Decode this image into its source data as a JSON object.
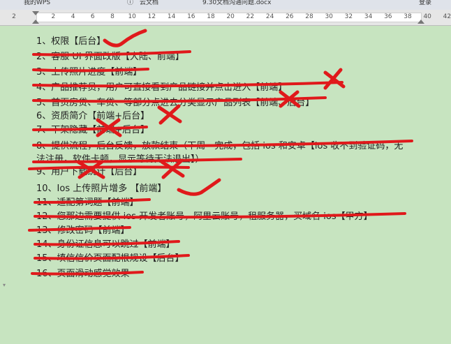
{
  "tabs": [
    {
      "label": "我的WPS"
    },
    {
      "label": "云文档"
    },
    {
      "label": "9.30文档沟通问题.docx"
    },
    {
      "label": "登录"
    }
  ],
  "ruler": {
    "ticks": [
      "2",
      "",
      "2",
      "4",
      "6",
      "8",
      "10",
      "12",
      "14",
      "16",
      "18",
      "20",
      "22",
      "24",
      "26",
      "28",
      "30",
      "32",
      "34",
      "36",
      "38",
      "40",
      "42"
    ]
  },
  "document": {
    "lines": [
      "1、权限【后台】",
      "2、客服 UI 界面改版【大陆、前端】",
      "3、上传照片进度【前端】",
      "4、产品推荐员，用户可直接看到产品链接并点击进入【前端】",
      "5、首页房贷、车贷、等部分点进去分类显示产品列表【前端、后台】",
      "6、资质简介【前端+后台】",
      "7、下架隐藏【前端+后台】",
      "8、提供流程，后台反馈，放款结束（下周一完成，包括 ios 和安卓【ios 收不到验证码，无",
      "法注册，软件卡顿，显示等待无法退出】）",
      "9、用户下载统计【后台】",
      "10、Ios 上传照片增多 【前端】",
      "11、适配第词题【前端】",
      "12、您那边需要提供 ios 开发者账号，阿里云账号，租服务器，买域名 ios【甲方】",
      "13、修改密码【前端】",
      "14、身份证信息可以跳过【前端】",
      "15、填信信价页面配根规设【后台】",
      "16、页面滑动感觉效果"
    ]
  },
  "colors": {
    "page_background": "#c7e4c0",
    "annotation_ink": "#e0191b",
    "text": "#222222"
  }
}
